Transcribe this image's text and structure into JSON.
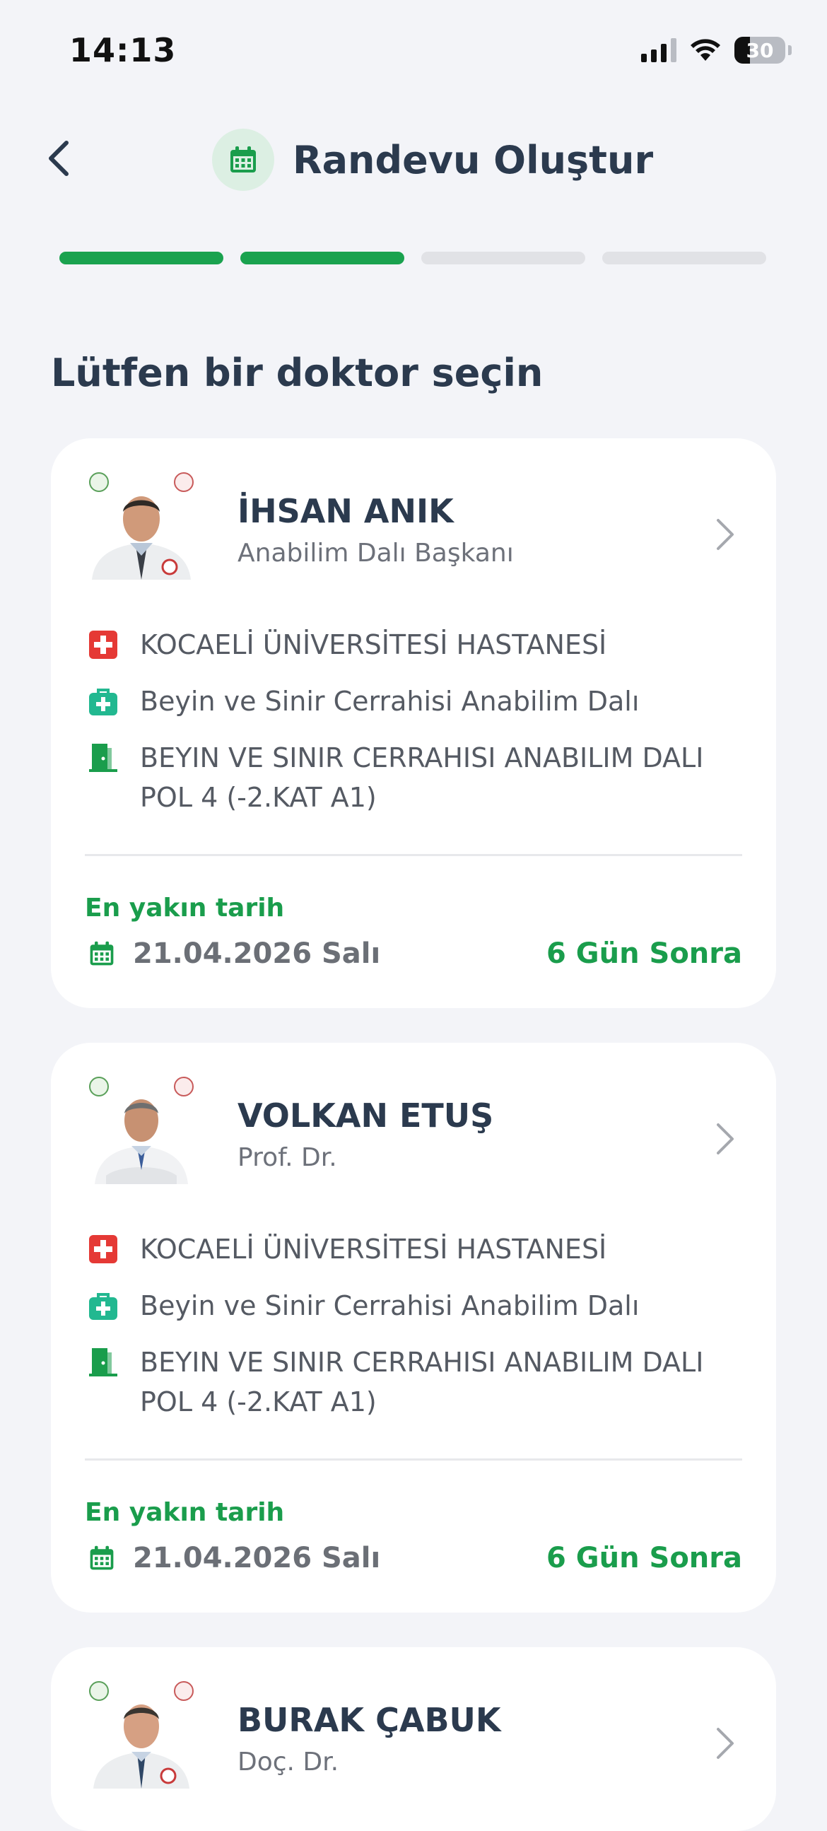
{
  "status_bar": {
    "time": "14:13",
    "battery": "30"
  },
  "header": {
    "title": "Randevu Oluştur",
    "back_icon": "chevron-left-icon",
    "title_icon": "calendar-icon"
  },
  "progress": {
    "total_steps": 4,
    "completed_steps": 2,
    "active_color": "#1aa24f"
  },
  "section_title": "Lütfen bir doktor seçin",
  "colors": {
    "accent": "#1aa24f",
    "hospital_red": "#e53935",
    "dept_teal": "#22b890"
  },
  "doctors": [
    {
      "name": "İHSAN ANIK",
      "title": "Anabilim Dalı Başkanı",
      "hospital": "KOCAELİ ÜNİVERSİTESİ HASTANESİ",
      "department": "Beyin ve Sinir Cerrahisi Anabilim Dalı",
      "clinic": "BEYIN VE SINIR CERRAHISI ANABILIM DALI POL 4 (-2.KAT A1)",
      "nearest_label": "En yakın tarih",
      "nearest_date": "21.04.2026 Salı",
      "days_until": "6 Gün Sonra"
    },
    {
      "name": "VOLKAN ETUŞ",
      "title": "Prof. Dr.",
      "hospital": "KOCAELİ ÜNİVERSİTESİ HASTANESİ",
      "department": "Beyin ve Sinir Cerrahisi Anabilim Dalı",
      "clinic": "BEYIN VE SINIR CERRAHISI ANABILIM DALI POL 4 (-2.KAT A1)",
      "nearest_label": "En yakın tarih",
      "nearest_date": "21.04.2026 Salı",
      "days_until": "6 Gün Sonra"
    },
    {
      "name": "BURAK ÇABUK",
      "title": "Doç. Dr."
    }
  ]
}
